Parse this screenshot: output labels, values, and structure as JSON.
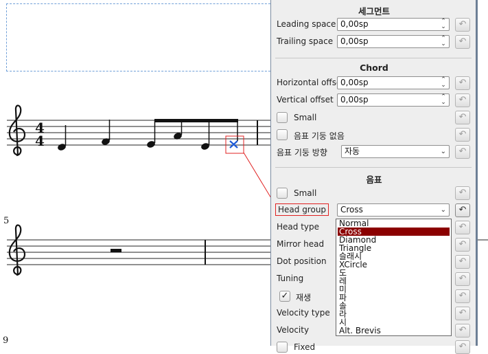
{
  "score": {
    "time_signature": {
      "top": "4",
      "bottom": "4"
    },
    "measure_numbers": [
      "5",
      "9"
    ]
  },
  "inspector": {
    "segment": {
      "title": "세그먼트",
      "leading_label": "Leading space",
      "leading_value": "0,00sp",
      "trailing_label": "Trailing space",
      "trailing_value": "0,00sp"
    },
    "chord": {
      "title": "Chord",
      "hoffset_label": "Horizontal offset",
      "hoffset_value": "0,00sp",
      "voffset_label": "Vertical offset",
      "voffset_value": "0,00sp",
      "small_label": "Small",
      "nostem_label": "음표 기둥 없음",
      "stemdir_label": "음표 기둥 방향",
      "stemdir_value": "자동"
    },
    "note": {
      "title": "음표",
      "small_label": "Small",
      "headgroup_label": "Head group",
      "headgroup_value": "Cross",
      "headtype_label": "Head type",
      "mirror_label": "Mirror head",
      "dotpos_label": "Dot position",
      "tuning_label": "Tuning",
      "play_label": "재생",
      "velocity_type_label": "Velocity type",
      "velocity_label": "Velocity",
      "fixed_label": "Fixed"
    }
  },
  "headgroup_options": [
    "Normal",
    "Cross",
    "Diamond",
    "Triangle",
    "슬래시",
    "XCircle",
    "도",
    "레",
    "미",
    "파",
    "솔",
    "라",
    "시",
    "Alt. Brevis"
  ],
  "headgroup_selected_index": 1,
  "colors": {
    "selection": "#8b0000",
    "highlight_box": "#e02020",
    "note_selected": "#1f5bd6"
  },
  "icons": {
    "reset": "reset-arrow-icon",
    "check": "checkmark-icon"
  }
}
